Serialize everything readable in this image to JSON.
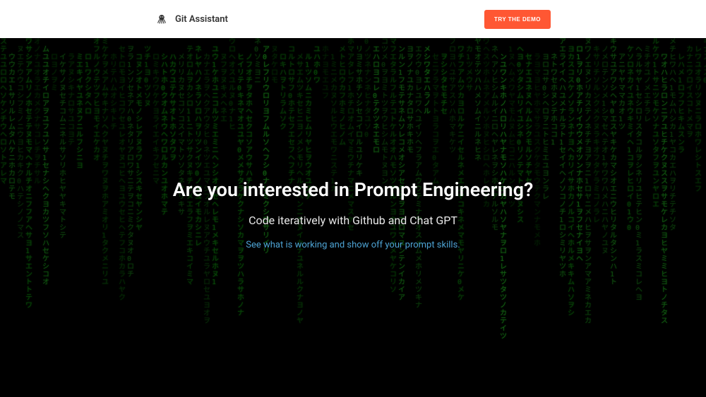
{
  "header": {
    "brand": "Git Assistant",
    "cta": "TRY THE DEMO"
  },
  "hero": {
    "title": "Are you interested in Prompt Engineering?",
    "subtitle": "Code iteratively with Github and Chat GPT",
    "link": "See what is working and show off your prompt skills."
  }
}
